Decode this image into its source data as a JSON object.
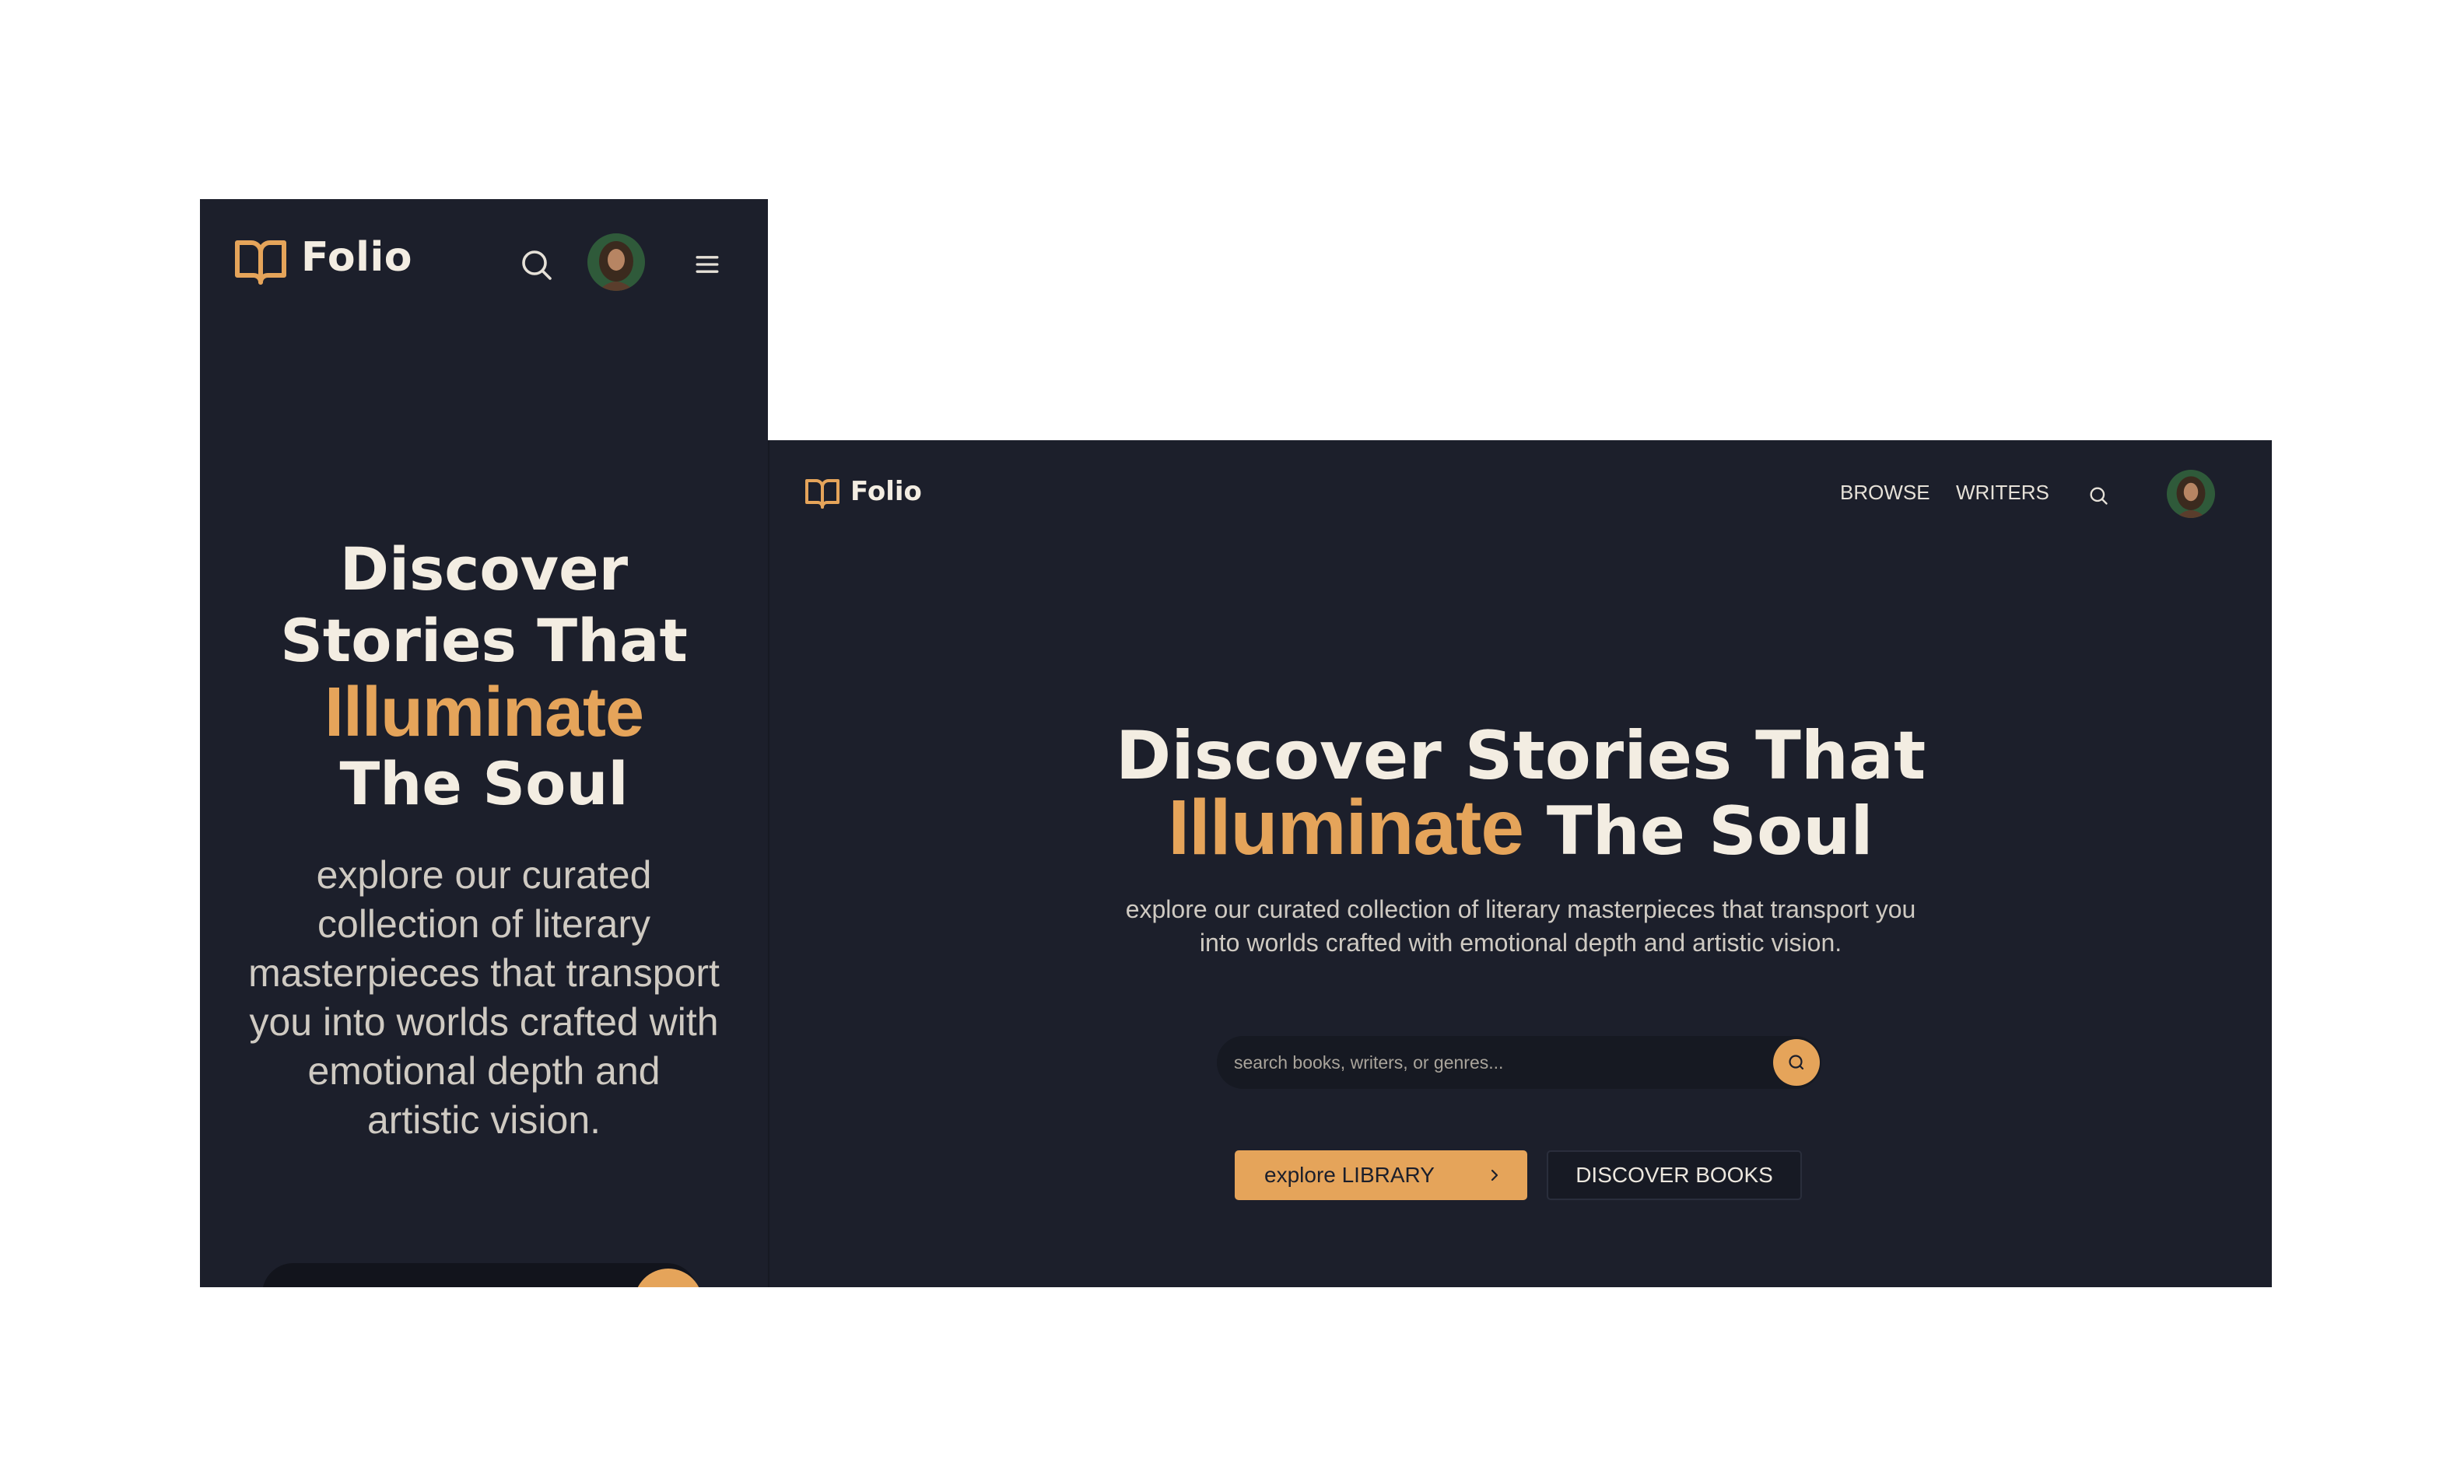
{
  "brand": {
    "name": "Folio",
    "accent_color": "#e5a45a",
    "background_color": "#1c1f2b",
    "logo_icon": "open-book-icon"
  },
  "mobile": {
    "header": {
      "search_icon": "search-icon",
      "avatar": "user-avatar",
      "menu_icon": "hamburger-menu-icon"
    },
    "hero": {
      "title_line1": "Discover",
      "title_line2": "Stories That",
      "title_accent": "Illuminate",
      "title_line4": "The Soul",
      "description": "explore our curated collection of literary masterpieces that transport you into worlds crafted with emotional depth and artistic vision."
    }
  },
  "desktop": {
    "nav": {
      "browse": "BROWSE",
      "writers": "WRITERS",
      "search_icon": "search-icon",
      "avatar": "user-avatar"
    },
    "hero": {
      "title_part1": "Discover Stories That",
      "title_accent": "Illuminate",
      "title_part2": "The Soul",
      "description": "explore our curated collection of literary masterpieces that transport you into worlds crafted with emotional depth and artistic vision."
    },
    "search": {
      "placeholder": "search books, writers, or genres..."
    },
    "buttons": {
      "explore_library": "explore LIBRARY",
      "discover_books": "DISCOVER BOOKS"
    }
  }
}
